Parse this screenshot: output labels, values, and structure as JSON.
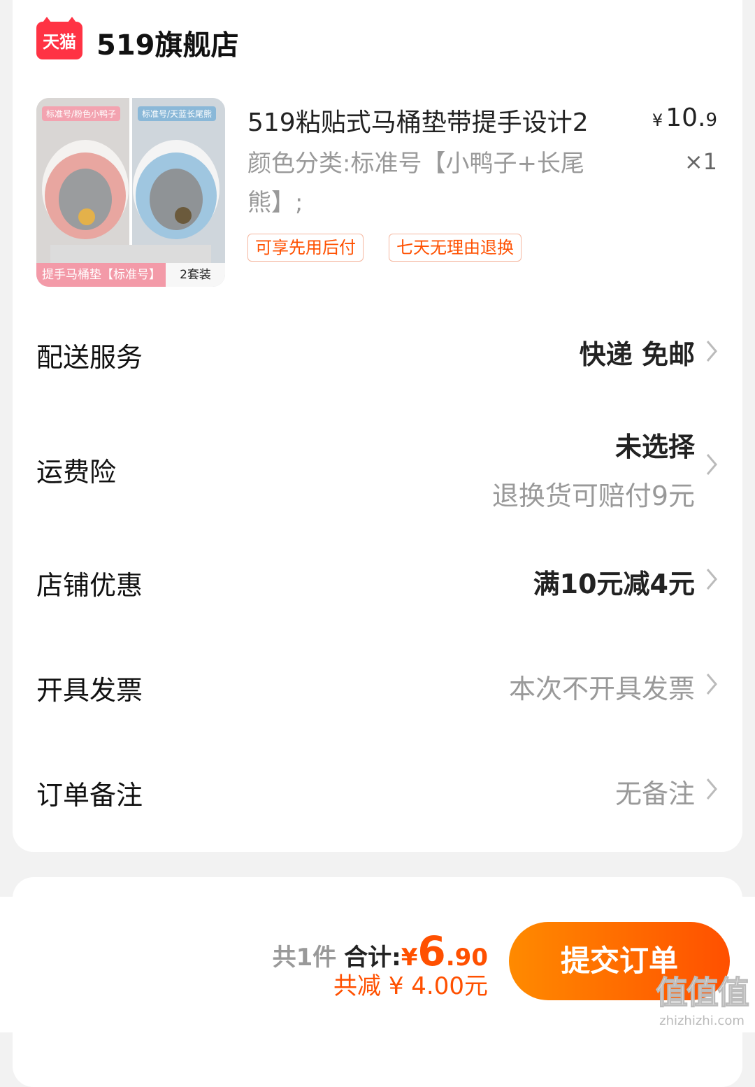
{
  "shop": {
    "badge": "天猫",
    "name": "519旗舰店"
  },
  "product": {
    "image_tags": [
      "标准号/粉色小鸭子",
      "标准号/天蓝长尾熊"
    ],
    "image_caption": "提手马桶垫【标准号】",
    "image_pack": "2套装",
    "title": "519粘贴式马桶垫带提手设计2",
    "price_symbol": "¥",
    "price_int": "10.",
    "price_dec": "9",
    "variant": "颜色分类:标准号【小鸭子+长尾熊】;",
    "qty": "×1",
    "tags": [
      "可享先用后付",
      "七天无理由退换"
    ]
  },
  "rows": {
    "delivery": {
      "label": "配送服务",
      "value": "快递 免邮"
    },
    "insurance": {
      "label": "运费险",
      "value": "未选择",
      "sub": "退换货可赔付9元"
    },
    "coupon": {
      "label": "店铺优惠",
      "value": "满10元减4元"
    },
    "invoice": {
      "label": "开具发票",
      "value": "本次不开具发票"
    },
    "note": {
      "label": "订单备注",
      "value": "无备注"
    }
  },
  "footer": {
    "count": "共1件",
    "total_label": "合计:",
    "currency": "¥",
    "total_int": "6",
    "total_dec": ".90",
    "discount": "共减 ¥ 4.00元",
    "submit": "提交订单"
  },
  "watermark": {
    "main": "值值值",
    "sub": "zhizhizhi.com"
  },
  "colors": {
    "accent": "#ff5000",
    "tmall": "#ff3344"
  }
}
